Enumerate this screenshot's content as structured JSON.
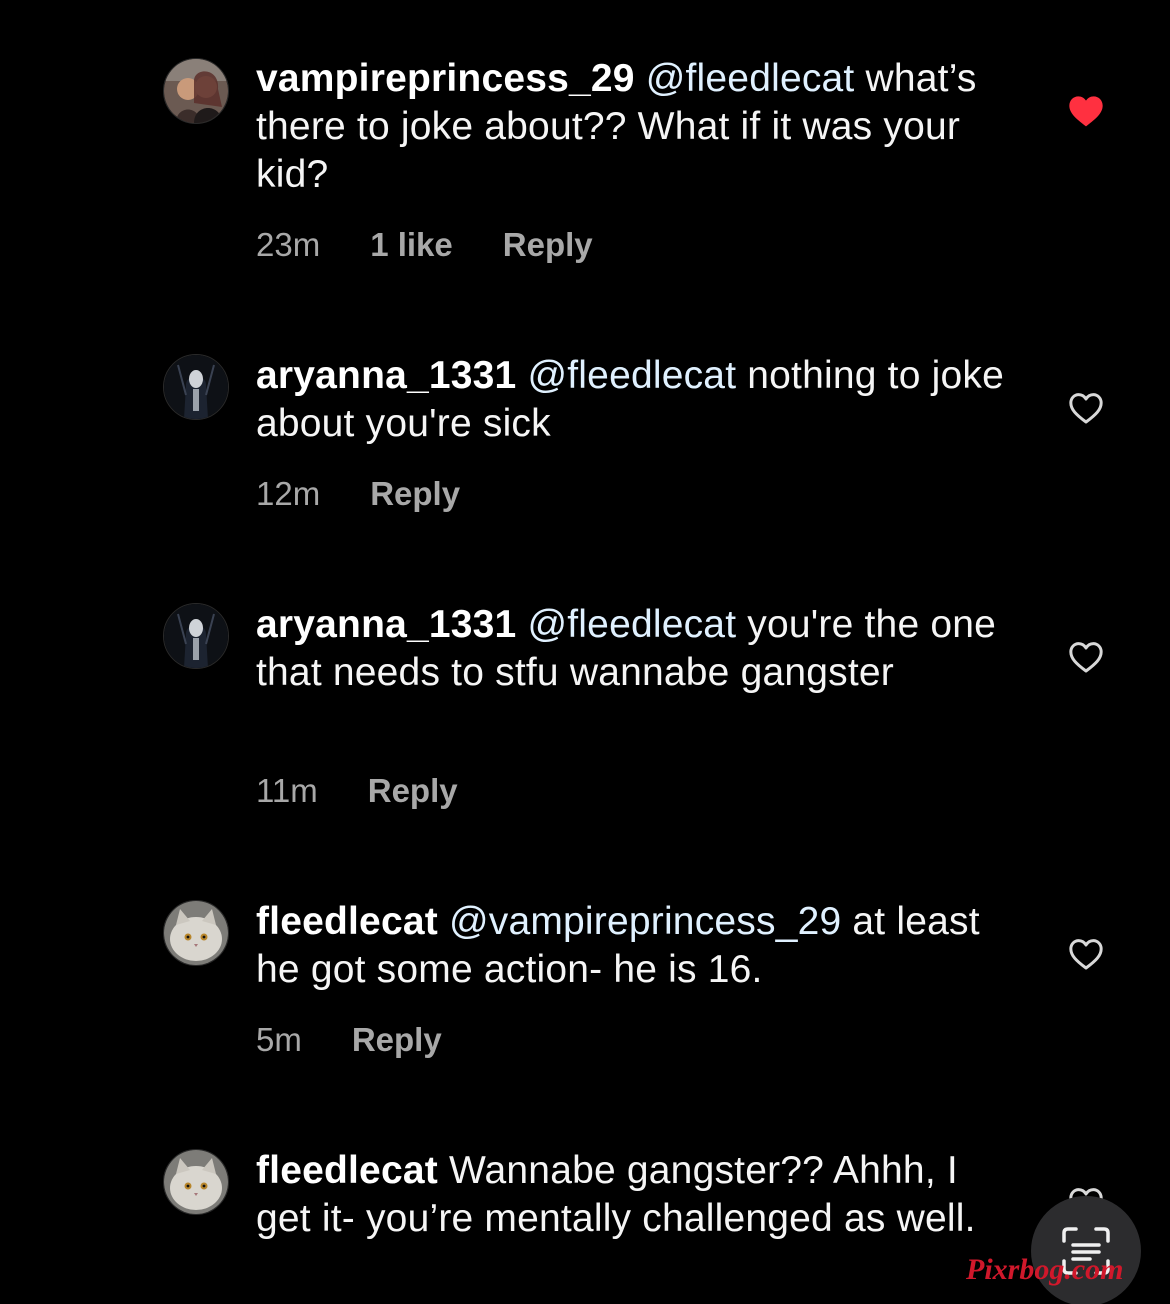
{
  "comments": [
    {
      "username": "vampireprincess_29",
      "mention": "@fleedlecat",
      "text": "what’s there to joke about?? What if it was your kid?",
      "time": "23m",
      "likes": "1 like",
      "reply": "Reply",
      "liked": true
    },
    {
      "username": "aryanna_1331",
      "mention": "@fleedlecat",
      "text": "nothing to joke about you're sick",
      "time": "12m",
      "reply": "Reply",
      "liked": false
    },
    {
      "username": "aryanna_1331",
      "mention": "@fleedlecat",
      "text": "you're the one that needs to stfu wannabe gangster",
      "time": "11m",
      "reply": "Reply",
      "liked": false
    },
    {
      "username": "fleedlecat",
      "mention": "@vampireprincess_29",
      "text": "at least he got some action- he is 16.",
      "time": "5m",
      "reply": "Reply",
      "liked": false
    },
    {
      "username": "fleedlecat",
      "mention": "",
      "text": "Wannabe gangster?? Ahhh, I get it- you’re mentally challenged as well.",
      "liked": false
    }
  ],
  "watermark": "Pixrbog.com",
  "colors": {
    "background": "#000000",
    "liked_heart": "#ff3040",
    "secondary_text": "#a8a8a8",
    "mention": "#e0f1ff"
  },
  "icons": {
    "liked": "heart-filled-icon",
    "unliked": "heart-outline-icon",
    "fab": "scan-text-icon"
  }
}
